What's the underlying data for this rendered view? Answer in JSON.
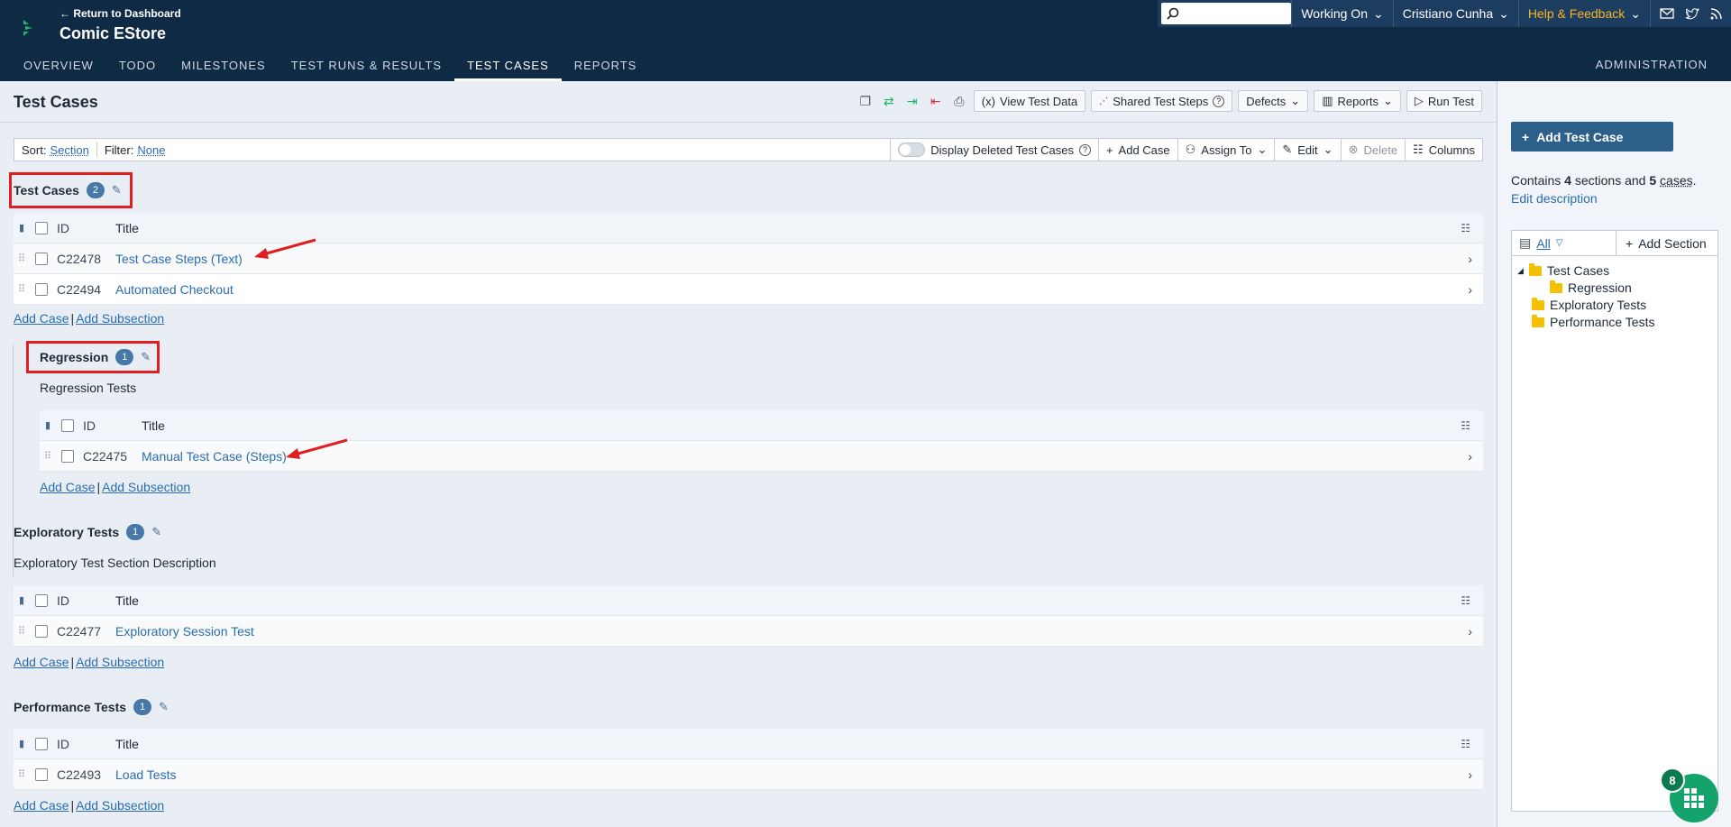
{
  "header": {
    "back_link": "Return to Dashboard",
    "project": "Comic EStore",
    "search_placeholder": "",
    "working_on": "Working On",
    "user": "Cristiano Cunha",
    "help": "Help & Feedback",
    "administration": "ADMINISTRATION",
    "tabs": [
      "OVERVIEW",
      "TODO",
      "MILESTONES",
      "TEST RUNS & RESULTS",
      "TEST CASES",
      "REPORTS"
    ]
  },
  "page": {
    "title": "Test Cases",
    "view_test_data": "View Test Data",
    "shared_test_steps": "Shared Test Steps",
    "defects": "Defects",
    "reports": "Reports",
    "run_test": "Run Test"
  },
  "filter": {
    "sort_label": "Sort:",
    "sort_value": "Section",
    "filter_label": "Filter:",
    "filter_value": "None",
    "display_deleted": "Display Deleted Test Cases",
    "add_case": "Add Case",
    "assign_to": "Assign To",
    "edit": "Edit",
    "delete": "Delete",
    "columns": "Columns"
  },
  "columns": {
    "id": "ID",
    "title": "Title"
  },
  "links": {
    "add_case": "Add Case",
    "add_subsection": "Add Subsection"
  },
  "sections": [
    {
      "name": "Test Cases",
      "count": "2",
      "description": "",
      "rows": [
        {
          "id": "C22478",
          "title": "Test Case Steps (Text)"
        },
        {
          "id": "C22494",
          "title": "Automated Checkout"
        }
      ]
    },
    {
      "name": "Regression",
      "count": "1",
      "description": "Regression Tests",
      "rows": [
        {
          "id": "C22475",
          "title": "Manual Test Case (Steps)"
        }
      ]
    },
    {
      "name": "Exploratory Tests",
      "count": "1",
      "description": "Exploratory Test Section Description",
      "rows": [
        {
          "id": "C22477",
          "title": "Exploratory Session Test"
        }
      ]
    },
    {
      "name": "Performance Tests",
      "count": "1",
      "description": "",
      "rows": [
        {
          "id": "C22493",
          "title": "Load Tests"
        }
      ]
    }
  ],
  "sidebar": {
    "add_test_case": "Add Test Case",
    "summary_pre": "Contains",
    "sections_count": "4",
    "summary_mid": "sections and",
    "cases_count": "5",
    "cases_word": "cases",
    "edit_description": "Edit description",
    "tree_all": "All",
    "add_section": "Add Section",
    "tree": [
      "Test Cases",
      "Regression",
      "Exploratory Tests",
      "Performance Tests"
    ]
  },
  "fab": {
    "badge": "8"
  },
  "colors": {
    "header_bg": "#0f2a44",
    "accent": "#2d5f8b",
    "link": "#2b6cb0",
    "highlight": "#e02020"
  }
}
